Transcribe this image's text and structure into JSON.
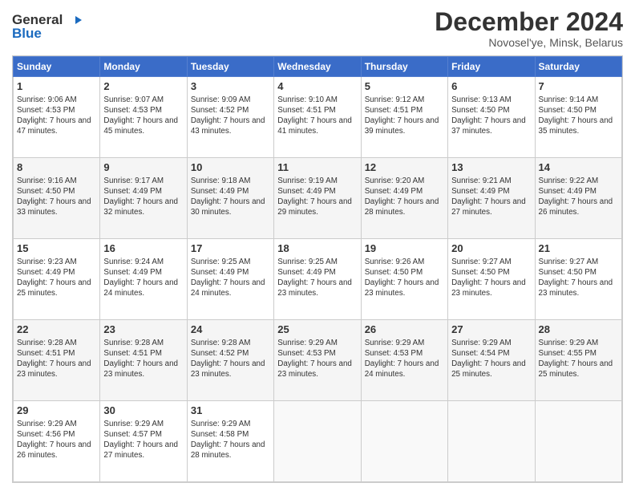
{
  "logo": {
    "line1": "General",
    "line2": "Blue"
  },
  "title": "December 2024",
  "subtitle": "Novosel'ye, Minsk, Belarus",
  "weekdays": [
    "Sunday",
    "Monday",
    "Tuesday",
    "Wednesday",
    "Thursday",
    "Friday",
    "Saturday"
  ],
  "weeks": [
    [
      {
        "day": "1",
        "sunrise": "9:06 AM",
        "sunset": "4:53 PM",
        "daylight": "7 hours and 47 minutes."
      },
      {
        "day": "2",
        "sunrise": "9:07 AM",
        "sunset": "4:53 PM",
        "daylight": "7 hours and 45 minutes."
      },
      {
        "day": "3",
        "sunrise": "9:09 AM",
        "sunset": "4:52 PM",
        "daylight": "7 hours and 43 minutes."
      },
      {
        "day": "4",
        "sunrise": "9:10 AM",
        "sunset": "4:51 PM",
        "daylight": "7 hours and 41 minutes."
      },
      {
        "day": "5",
        "sunrise": "9:12 AM",
        "sunset": "4:51 PM",
        "daylight": "7 hours and 39 minutes."
      },
      {
        "day": "6",
        "sunrise": "9:13 AM",
        "sunset": "4:50 PM",
        "daylight": "7 hours and 37 minutes."
      },
      {
        "day": "7",
        "sunrise": "9:14 AM",
        "sunset": "4:50 PM",
        "daylight": "7 hours and 35 minutes."
      }
    ],
    [
      {
        "day": "8",
        "sunrise": "9:16 AM",
        "sunset": "4:50 PM",
        "daylight": "7 hours and 33 minutes."
      },
      {
        "day": "9",
        "sunrise": "9:17 AM",
        "sunset": "4:49 PM",
        "daylight": "7 hours and 32 minutes."
      },
      {
        "day": "10",
        "sunrise": "9:18 AM",
        "sunset": "4:49 PM",
        "daylight": "7 hours and 30 minutes."
      },
      {
        "day": "11",
        "sunrise": "9:19 AM",
        "sunset": "4:49 PM",
        "daylight": "7 hours and 29 minutes."
      },
      {
        "day": "12",
        "sunrise": "9:20 AM",
        "sunset": "4:49 PM",
        "daylight": "7 hours and 28 minutes."
      },
      {
        "day": "13",
        "sunrise": "9:21 AM",
        "sunset": "4:49 PM",
        "daylight": "7 hours and 27 minutes."
      },
      {
        "day": "14",
        "sunrise": "9:22 AM",
        "sunset": "4:49 PM",
        "daylight": "7 hours and 26 minutes."
      }
    ],
    [
      {
        "day": "15",
        "sunrise": "9:23 AM",
        "sunset": "4:49 PM",
        "daylight": "7 hours and 25 minutes."
      },
      {
        "day": "16",
        "sunrise": "9:24 AM",
        "sunset": "4:49 PM",
        "daylight": "7 hours and 24 minutes."
      },
      {
        "day": "17",
        "sunrise": "9:25 AM",
        "sunset": "4:49 PM",
        "daylight": "7 hours and 24 minutes."
      },
      {
        "day": "18",
        "sunrise": "9:25 AM",
        "sunset": "4:49 PM",
        "daylight": "7 hours and 23 minutes."
      },
      {
        "day": "19",
        "sunrise": "9:26 AM",
        "sunset": "4:50 PM",
        "daylight": "7 hours and 23 minutes."
      },
      {
        "day": "20",
        "sunrise": "9:27 AM",
        "sunset": "4:50 PM",
        "daylight": "7 hours and 23 minutes."
      },
      {
        "day": "21",
        "sunrise": "9:27 AM",
        "sunset": "4:50 PM",
        "daylight": "7 hours and 23 minutes."
      }
    ],
    [
      {
        "day": "22",
        "sunrise": "9:28 AM",
        "sunset": "4:51 PM",
        "daylight": "7 hours and 23 minutes."
      },
      {
        "day": "23",
        "sunrise": "9:28 AM",
        "sunset": "4:51 PM",
        "daylight": "7 hours and 23 minutes."
      },
      {
        "day": "24",
        "sunrise": "9:28 AM",
        "sunset": "4:52 PM",
        "daylight": "7 hours and 23 minutes."
      },
      {
        "day": "25",
        "sunrise": "9:29 AM",
        "sunset": "4:53 PM",
        "daylight": "7 hours and 23 minutes."
      },
      {
        "day": "26",
        "sunrise": "9:29 AM",
        "sunset": "4:53 PM",
        "daylight": "7 hours and 24 minutes."
      },
      {
        "day": "27",
        "sunrise": "9:29 AM",
        "sunset": "4:54 PM",
        "daylight": "7 hours and 25 minutes."
      },
      {
        "day": "28",
        "sunrise": "9:29 AM",
        "sunset": "4:55 PM",
        "daylight": "7 hours and 25 minutes."
      }
    ],
    [
      {
        "day": "29",
        "sunrise": "9:29 AM",
        "sunset": "4:56 PM",
        "daylight": "7 hours and 26 minutes."
      },
      {
        "day": "30",
        "sunrise": "9:29 AM",
        "sunset": "4:57 PM",
        "daylight": "7 hours and 27 minutes."
      },
      {
        "day": "31",
        "sunrise": "9:29 AM",
        "sunset": "4:58 PM",
        "daylight": "7 hours and 28 minutes."
      },
      null,
      null,
      null,
      null
    ]
  ]
}
